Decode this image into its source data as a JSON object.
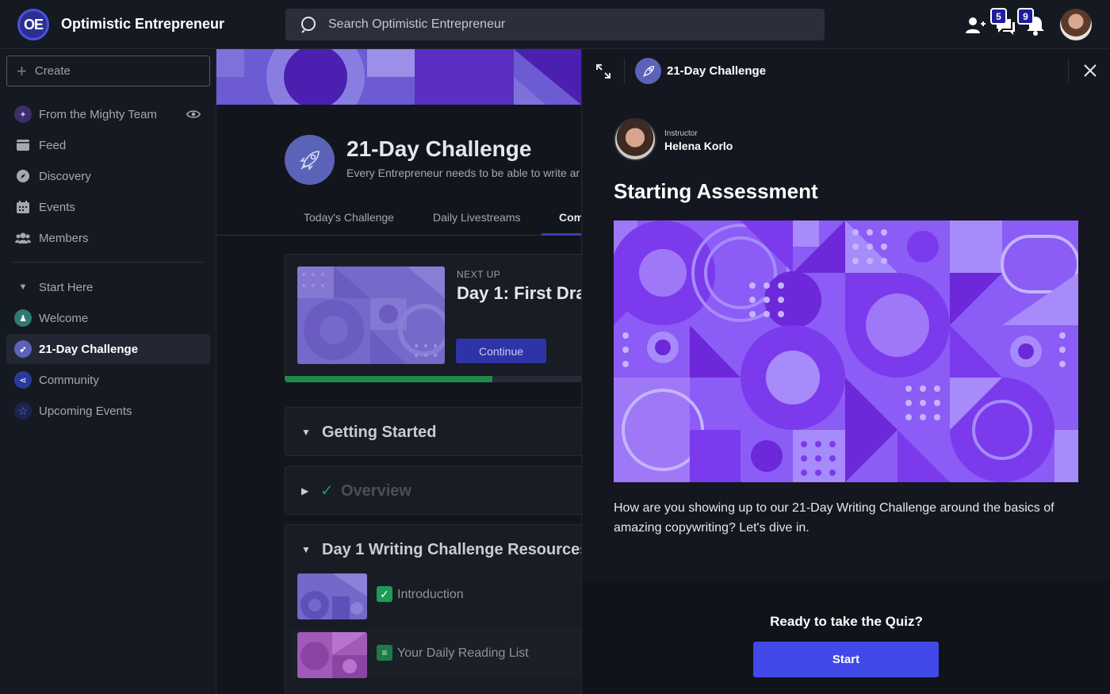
{
  "app": {
    "logo_text": "OE",
    "title": "Optimistic Entrepreneur"
  },
  "search": {
    "placeholder": "Search Optimistic Entrepreneur"
  },
  "header": {
    "chat_badge": "5",
    "notification_badge": "9"
  },
  "sidebar": {
    "create_label": "Create",
    "items": [
      {
        "label": "From the Mighty Team",
        "icon": "sparkle-icon"
      },
      {
        "label": "Feed",
        "icon": "feed-icon"
      },
      {
        "label": "Discovery",
        "icon": "compass-icon"
      },
      {
        "label": "Events",
        "icon": "calendar-icon"
      },
      {
        "label": "Members",
        "icon": "members-icon"
      },
      {
        "label": "Start Here",
        "icon": "caret-down-icon"
      },
      {
        "label": "Welcome",
        "icon": "welcome-icon"
      },
      {
        "label": "21-Day Challenge",
        "icon": "rocket-icon"
      },
      {
        "label": "Community",
        "icon": "share-icon"
      },
      {
        "label": "Upcoming Events",
        "icon": "star-icon"
      }
    ]
  },
  "course": {
    "title": "21-Day Challenge",
    "subtitle": "Every Entrepreneur needs to be able to write ar",
    "tabs": [
      "Today's Challenge",
      "Daily Livestreams",
      "Com"
    ],
    "next_up": {
      "label": "NEXT UP",
      "title": "Day 1: First Dra",
      "button": "Continue",
      "progress": 0.69
    },
    "sections": [
      {
        "title": "Getting Started"
      },
      {
        "title": "Overview"
      },
      {
        "title": "Day 1 Writing Challenge Resources"
      }
    ],
    "lessons": [
      {
        "label": "Introduction"
      },
      {
        "label": "Your Daily Reading List"
      }
    ]
  },
  "panel": {
    "title": "21-Day Challenge",
    "instructor_role": "Instructor",
    "instructor_name": "Helena Korlo",
    "heading": "Starting Assessment",
    "description": "How are you showing up to our 21-Day Writing Challenge around the basics of amazing copywriting? Let's dive in.",
    "ready_text": "Ready to take the Quiz?",
    "start_label": "Start"
  },
  "colors": {
    "accent": "#4149e8",
    "cover_purple": "#8b5cf6",
    "progress_green": "#1f8a4c"
  }
}
